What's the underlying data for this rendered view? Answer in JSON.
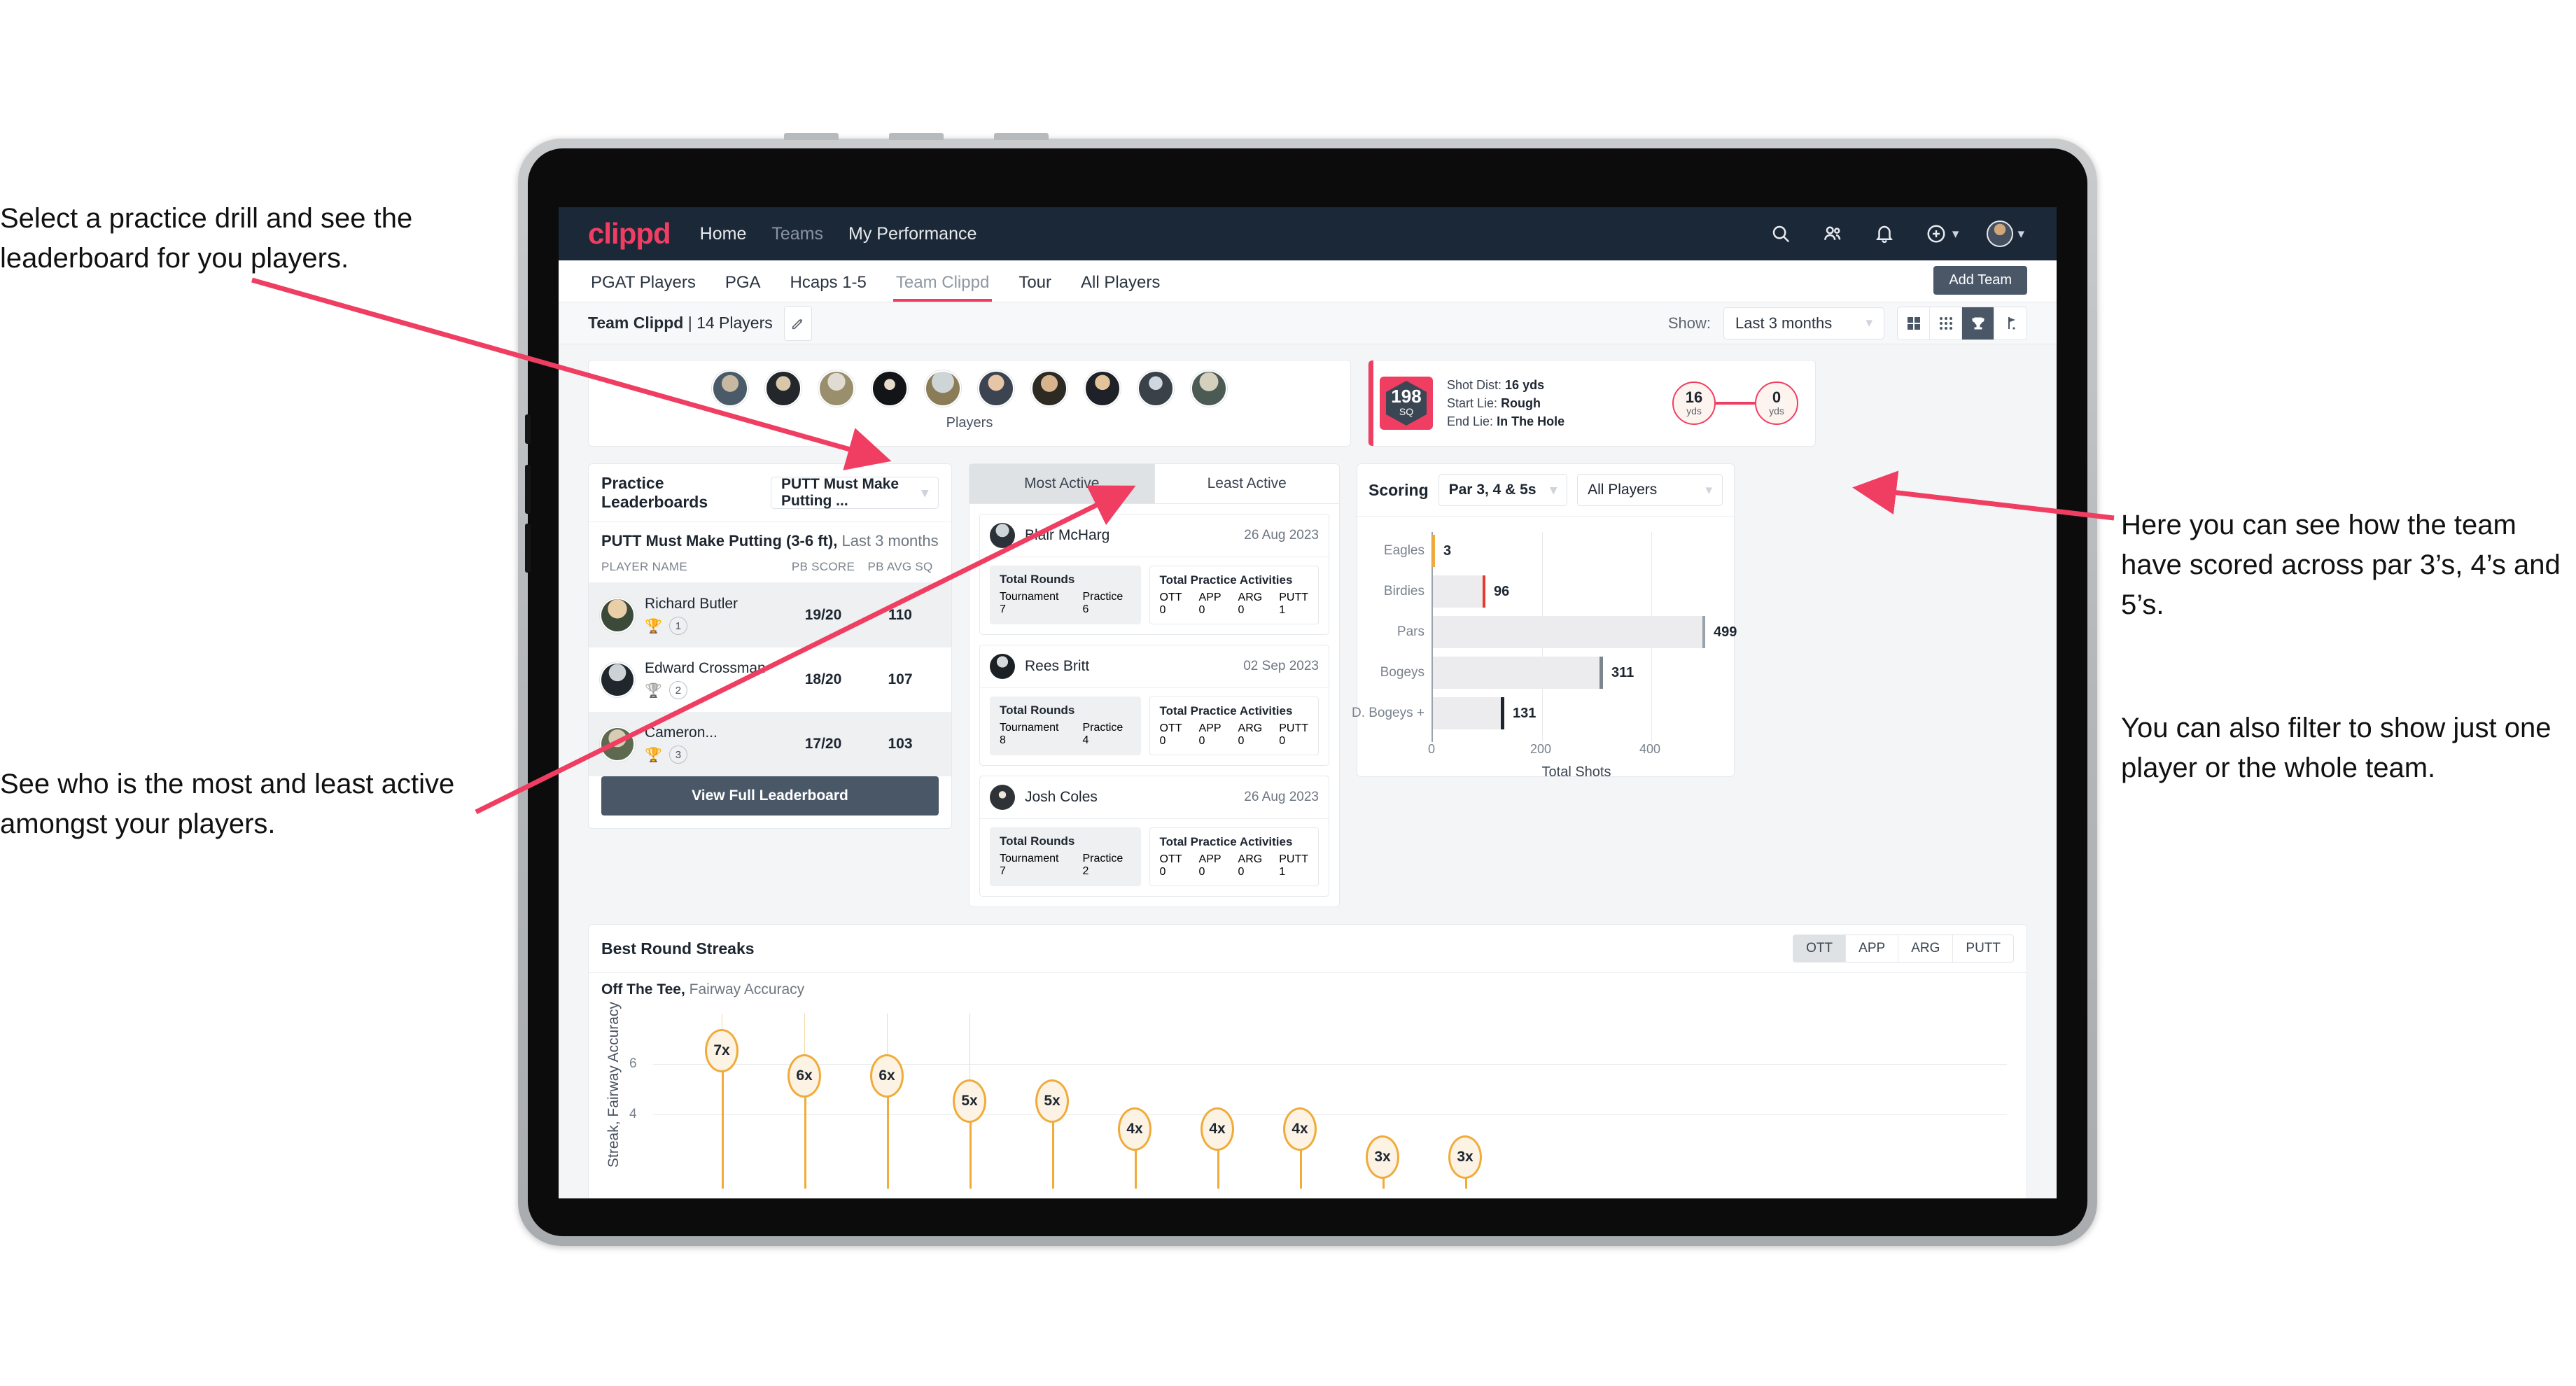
{
  "annotations": {
    "top_left": "Select a practice drill and see the leaderboard for you players.",
    "bottom_left": "See who is the most and least active amongst your players.",
    "right_1": "Here you can see how the team have scored across par 3’s, 4’s and 5’s.",
    "right_2": "You can also filter to show just one player or the whole team."
  },
  "navbar": {
    "brand": "clippd",
    "links": [
      {
        "label": "Home",
        "muted": false
      },
      {
        "label": "Teams",
        "muted": true
      },
      {
        "label": "My Performance",
        "muted": false
      }
    ],
    "icons": [
      "search-icon",
      "people-icon",
      "bell-icon",
      "plus-circle-icon",
      "avatar"
    ],
    "accent": "#ef3e62",
    "background": "#1b2838"
  },
  "tabs": {
    "items": [
      {
        "label": "PGAT Players",
        "active": false
      },
      {
        "label": "PGA",
        "active": false
      },
      {
        "label": "Hcaps 1-5",
        "active": false
      },
      {
        "label": "Team Clippd",
        "active": true
      },
      {
        "label": "Tour",
        "active": false
      },
      {
        "label": "All Players",
        "active": false
      }
    ],
    "add_team_label": "Add Team"
  },
  "subheader": {
    "team_name": "Team Clippd",
    "team_separator": " | ",
    "player_count": "14 Players",
    "edit_icon": "pencil-icon",
    "show_label": "Show:",
    "range_value": "Last 3 months",
    "view_modes": [
      {
        "name": "grid-view-icon",
        "active": false
      },
      {
        "name": "dots-view-icon",
        "active": false
      },
      {
        "name": "trophy-view-icon",
        "active": true
      },
      {
        "name": "flag-view-icon",
        "active": false
      }
    ]
  },
  "players_strip": {
    "caption": "Players",
    "avatar_count": 10
  },
  "shot_card": {
    "sq_value": "198",
    "sq_unit": "SQ",
    "shot_dist_label": "Shot Dist:",
    "shot_dist_value": "16 yds",
    "start_lie_label": "Start Lie:",
    "start_lie_value": "Rough",
    "end_lie_label": "End Lie:",
    "end_lie_value": "In The Hole",
    "from_value": "16",
    "from_unit": "yds",
    "to_value": "0",
    "to_unit": "yds"
  },
  "leaderboard": {
    "title": "Practice Leaderboards",
    "drill_select": "PUTT Must Make Putting ...",
    "subtitle_bold": "PUTT Must Make Putting (3-6 ft),",
    "subtitle_muted": "Last 3 months",
    "columns": [
      "PLAYER NAME",
      "PB SCORE",
      "PB AVG SQ"
    ],
    "rows": [
      {
        "name": "Richard Butler",
        "rank": "1",
        "trophy": "gold",
        "score": "19/20",
        "avg": "110"
      },
      {
        "name": "Edward Crossman",
        "rank": "2",
        "trophy": "silver",
        "score": "18/20",
        "avg": "107"
      },
      {
        "name": "Cameron...",
        "rank": "3",
        "trophy": "bronze",
        "score": "17/20",
        "avg": "103"
      }
    ],
    "button_label": "View Full Leaderboard"
  },
  "activity": {
    "tabs": [
      {
        "label": "Most Active",
        "active": true
      },
      {
        "label": "Least Active",
        "active": false
      }
    ],
    "rounds_title": "Total Rounds",
    "rounds_keys": [
      "Tournament",
      "Practice"
    ],
    "acts_title": "Total Practice Activities",
    "acts_keys": [
      "OTT",
      "APP",
      "ARG",
      "PUTT"
    ],
    "cards": [
      {
        "name": "Blair McHarg",
        "date": "26 Aug 2023",
        "rounds": [
          "7",
          "6"
        ],
        "acts": [
          "0",
          "0",
          "0",
          "1"
        ]
      },
      {
        "name": "Rees Britt",
        "date": "02 Sep 2023",
        "rounds": [
          "8",
          "4"
        ],
        "acts": [
          "0",
          "0",
          "0",
          "0"
        ]
      },
      {
        "name": "Josh Coles",
        "date": "26 Aug 2023",
        "rounds": [
          "7",
          "2"
        ],
        "acts": [
          "0",
          "0",
          "0",
          "1"
        ]
      }
    ]
  },
  "scoring": {
    "title": "Scoring",
    "par_select": "Par 3, 4 & 5s",
    "player_select": "All Players"
  },
  "streaks": {
    "title": "Best Round Streaks",
    "segments": [
      {
        "label": "OTT",
        "active": true
      },
      {
        "label": "APP",
        "active": false
      },
      {
        "label": "ARG",
        "active": false
      },
      {
        "label": "PUTT",
        "active": false
      }
    ],
    "sub_bold": "Off The Tee,",
    "sub_muted": "Fairway Accuracy"
  },
  "chart_data": [
    {
      "type": "bar",
      "orientation": "horizontal",
      "title": "Scoring",
      "categories": [
        "Eagles",
        "Birdies",
        "Pars",
        "Bogeys",
        "D. Bogeys +"
      ],
      "values": [
        3,
        96,
        499,
        311,
        131
      ],
      "bar_end_colors": [
        "#f0ab3a",
        "#e8392f",
        "#9aa2ab",
        "#7d868f",
        "#1d2530"
      ],
      "xlabel": "Total Shots",
      "ylabel": "",
      "xlim": [
        0,
        520
      ],
      "xticks": [
        0,
        200,
        400
      ],
      "grid": true,
      "legend": "none"
    },
    {
      "type": "scatter",
      "title": "Best Round Streaks",
      "subtitle": "Off The Tee, Fairway Accuracy",
      "ylabel": "Streak, Fairway Accuracy",
      "values": [
        7,
        6,
        6,
        5,
        5,
        4,
        4,
        4,
        3,
        3
      ],
      "labels": [
        "7x",
        "6x",
        "6x",
        "5x",
        "5x",
        "4x",
        "4x",
        "4x",
        "3x",
        "3x"
      ],
      "yticks": [
        4,
        6
      ],
      "ylim": [
        0,
        8
      ],
      "grid": true,
      "marker_color": "#f0ab3a",
      "marker_fill": "#fdf3e4"
    }
  ]
}
